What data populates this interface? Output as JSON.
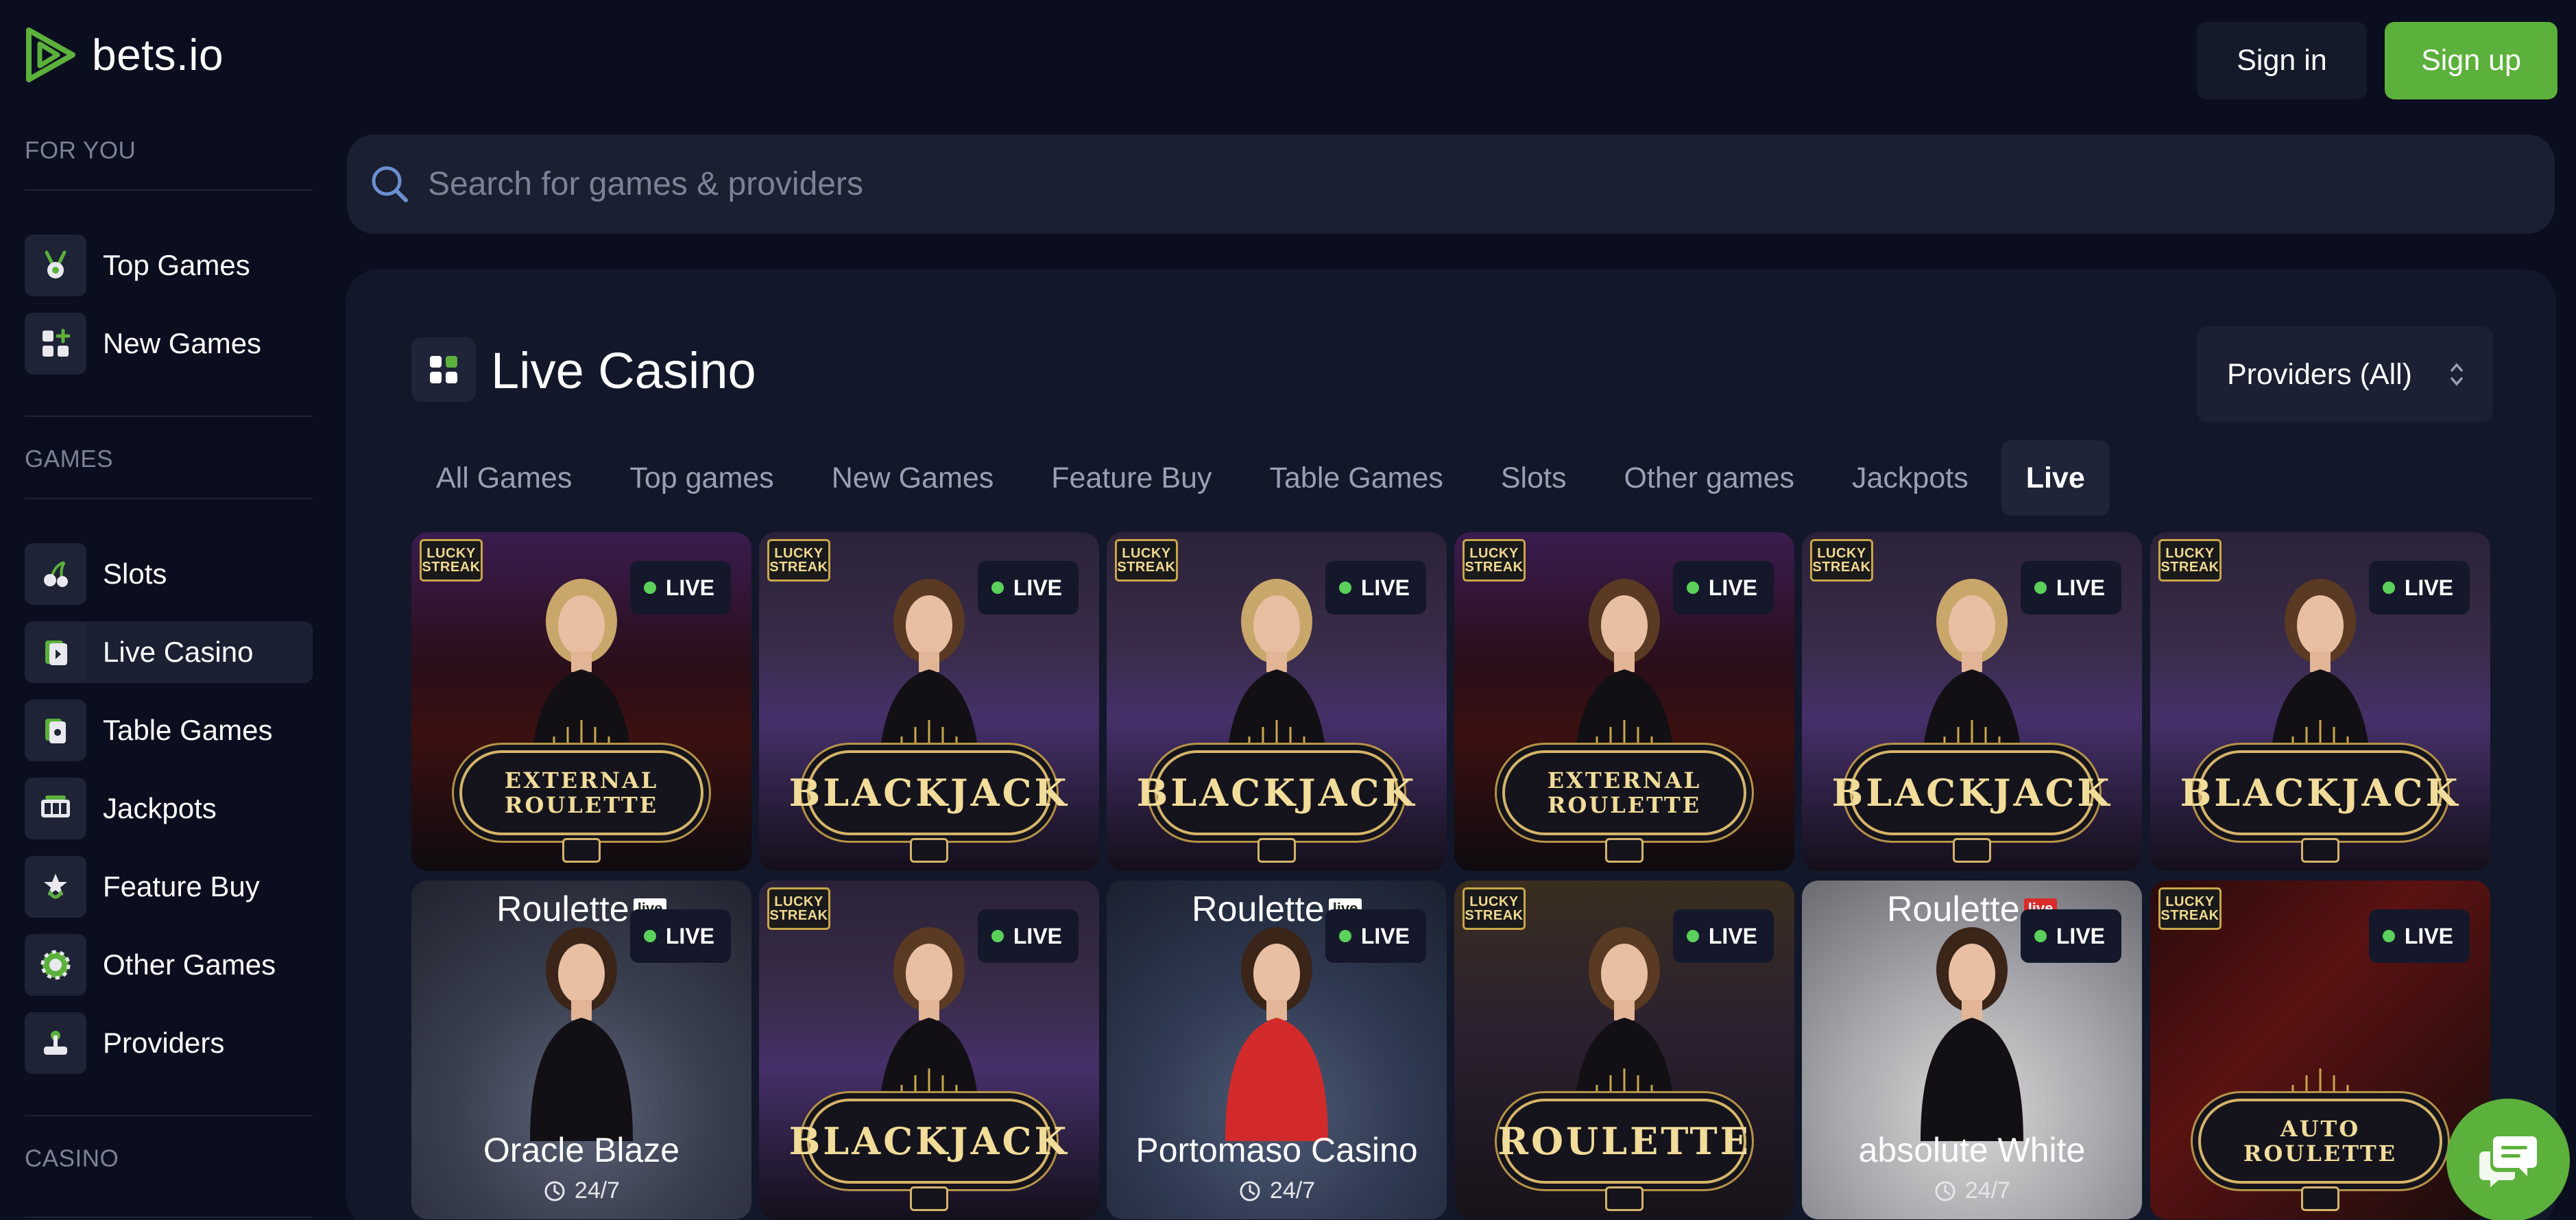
{
  "brand": {
    "name": "bets.io",
    "accent": "#5bb13b"
  },
  "header": {
    "signin_label": "Sign in",
    "signup_label": "Sign up"
  },
  "sidebar": {
    "sections": [
      {
        "title": "FOR YOU",
        "items": [
          {
            "label": "Top Games",
            "icon": "medal-icon"
          },
          {
            "label": "New Games",
            "icon": "grid-plus-icon"
          }
        ]
      },
      {
        "title": "GAMES",
        "items": [
          {
            "label": "Slots",
            "icon": "cherries-icon"
          },
          {
            "label": "Live Casino",
            "icon": "live-casino-icon",
            "active": true
          },
          {
            "label": "Table Games",
            "icon": "cards-icon"
          },
          {
            "label": "Jackpots",
            "icon": "jackpot-icon"
          },
          {
            "label": "Feature Buy",
            "icon": "feature-buy-icon"
          },
          {
            "label": "Other Games",
            "icon": "chip-icon"
          },
          {
            "label": "Providers",
            "icon": "joystick-icon"
          }
        ]
      },
      {
        "title": "CASINO",
        "items": []
      }
    ]
  },
  "search": {
    "placeholder": "Search for games & providers"
  },
  "main": {
    "title": "Live Casino",
    "providers_label": "Providers (All)",
    "tabs": [
      "All Games",
      "Top games",
      "New Games",
      "Feature Buy",
      "Table Games",
      "Slots",
      "Other games",
      "Jackpots",
      "Live"
    ],
    "active_tab": "Live",
    "live_badge": "LIVE",
    "lucky_streak": [
      "LUCKY",
      "STREAK"
    ],
    "games_row1": [
      {
        "type": "roulette-ext",
        "line1": "EXTERNAL",
        "line2": "ROULETTE"
      },
      {
        "type": "blackjack",
        "line1": "BLACKJACK"
      },
      {
        "type": "blackjack",
        "line1": "BLACKJACK"
      },
      {
        "type": "roulette-ext",
        "line1": "EXTERNAL",
        "line2": "ROULETTE"
      },
      {
        "type": "blackjack",
        "line1": "BLACKJACK"
      },
      {
        "type": "blackjack",
        "line1": "BLACKJACK"
      }
    ],
    "games_row2": [
      {
        "type": "rl",
        "brand": "Roulette",
        "tag": "live",
        "name": "Oracle Blaze",
        "hours": "24/7"
      },
      {
        "type": "blackjack",
        "line1": "BLACKJACK"
      },
      {
        "type": "rl",
        "brand": "Roulette",
        "tag": "live",
        "name": "Portomaso Casino",
        "hours": "24/7"
      },
      {
        "type": "roulette",
        "line1": "ROULETTE"
      },
      {
        "type": "rl",
        "brand": "Roulette",
        "tag": "live",
        "name": "absolute White",
        "hours": "24/7"
      },
      {
        "type": "auto",
        "line1": "AUTO",
        "line2": "ROULETTE"
      }
    ]
  }
}
